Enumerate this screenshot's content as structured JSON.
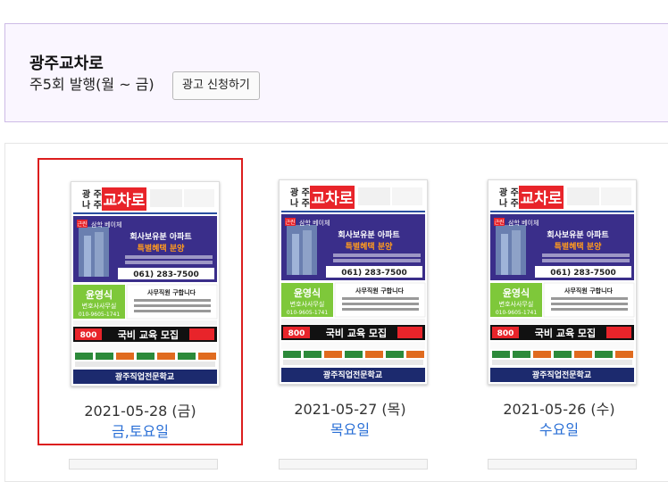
{
  "header": {
    "publication_name": "광주교차로",
    "schedule": "주5회 발행(월 ~ 금)",
    "ad_button_label": "광고 신청하기"
  },
  "issues": [
    {
      "date": "2021-05-28 (금)",
      "day_label": "금,토요일",
      "selected": true
    },
    {
      "date": "2021-05-27 (목)",
      "day_label": "목요일",
      "selected": false
    },
    {
      "date": "2021-05-26 (수)",
      "day_label": "수요일",
      "selected": false
    }
  ],
  "thumbnail": {
    "region_top": "광 주",
    "region_bottom": "나 주",
    "logo_text": "교차로",
    "housing_tag": "근린",
    "housing_location": "삼학 베이체",
    "housing_headline": "회사보유분 아파트",
    "housing_offer": "특별혜택 분양",
    "housing_phone": "061) 283-7500",
    "lawyer_name": "윤영식",
    "lawyer_office": "변호사사무실",
    "lawyer_phone": "010-9605-1741",
    "job_heading": "사무직원 구합니다",
    "edu_number": "800",
    "edu_title": "국비 교육 모집",
    "school_name": "광주직업전문학교"
  },
  "colors": {
    "accent_blue": "#2a6fd6",
    "selection_red": "#dc1e1e",
    "header_border": "#cdbbe6",
    "header_bg": "#faf6ff",
    "logo_red": "#e8242a",
    "ad_purple": "#3a2e8a",
    "ad_orange": "#ff9a1f",
    "lawyer_green": "#7ec83a"
  }
}
